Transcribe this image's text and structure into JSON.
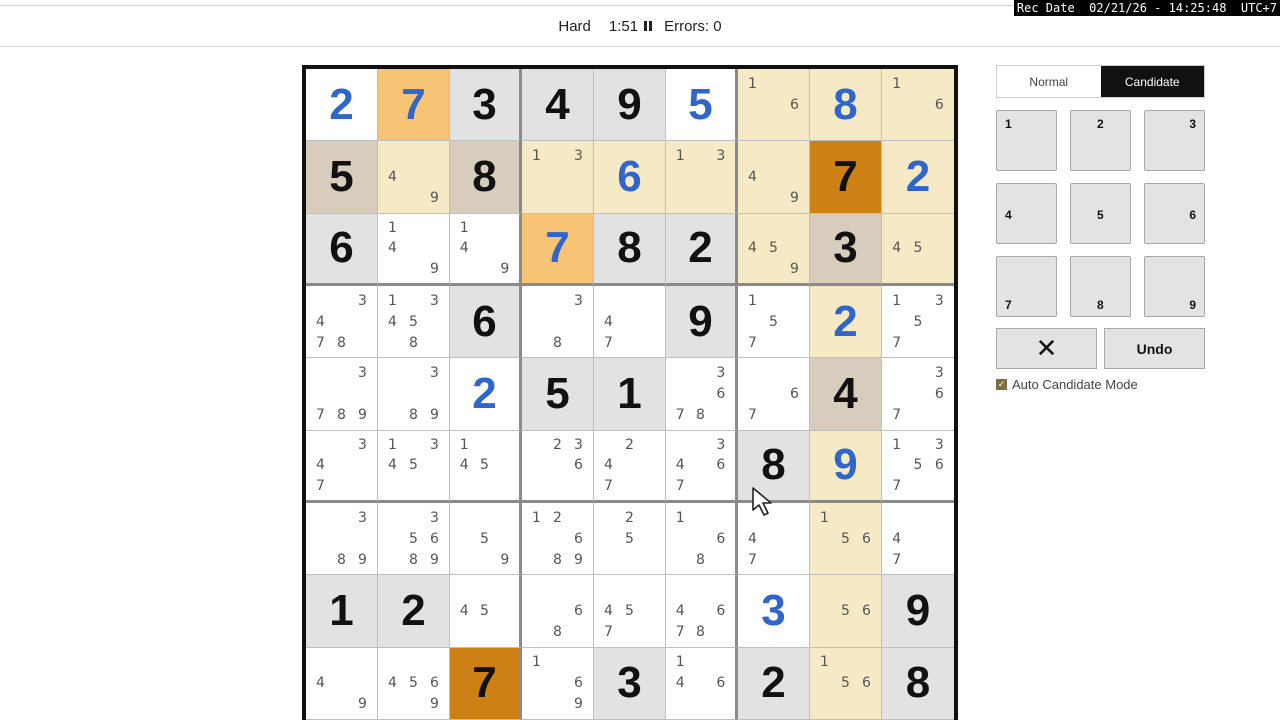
{
  "overlay": {
    "rec_date": "Rec Date  02/21/26 - 14:25:48  UTC+7"
  },
  "header": {
    "difficulty": "Hard",
    "timer": "1:51",
    "errors_label": "Errors: 0"
  },
  "colors": {
    "given": "#111111",
    "entered": "#2f66c9",
    "gray": "#e2e2e2",
    "tan": "#d8cdbc",
    "cream": "#f6e9c5",
    "orange": "#f6c474",
    "dark_orange": "#cd8114"
  },
  "board": [
    [
      {
        "v": "2",
        "t": "entered",
        "bg": "white"
      },
      {
        "v": "7",
        "t": "entered",
        "bg": "orange"
      },
      {
        "v": "3",
        "t": "given",
        "bg": "gray"
      },
      {
        "v": "4",
        "t": "given",
        "bg": "gray"
      },
      {
        "v": "9",
        "t": "given",
        "bg": "gray"
      },
      {
        "v": "5",
        "t": "entered",
        "bg": "white"
      },
      {
        "c": [
          "1",
          "",
          "",
          "",
          "",
          "6",
          "",
          "",
          ""
        ],
        "bg": "cream"
      },
      {
        "v": "8",
        "t": "entered",
        "bg": "cream"
      },
      {
        "c": [
          "1",
          "",
          "",
          "",
          "",
          "6",
          "",
          "",
          ""
        ],
        "bg": "cream"
      }
    ],
    [
      {
        "v": "5",
        "t": "given",
        "bg": "tan"
      },
      {
        "c": [
          "",
          "",
          "",
          "4",
          "",
          "",
          "",
          "",
          "9"
        ],
        "bg": "cream"
      },
      {
        "v": "8",
        "t": "given",
        "bg": "tan"
      },
      {
        "c": [
          "1",
          "",
          "3",
          "",
          "",
          "",
          "",
          "",
          ""
        ],
        "bg": "cream"
      },
      {
        "v": "6",
        "t": "entered",
        "bg": "cream"
      },
      {
        "c": [
          "1",
          "",
          "3",
          "",
          "",
          "",
          "",
          "",
          ""
        ],
        "bg": "cream"
      },
      {
        "c": [
          "",
          "",
          "",
          "4",
          "",
          "",
          "",
          "",
          "9"
        ],
        "bg": "cream"
      },
      {
        "v": "7",
        "t": "given",
        "bg": "dark_orange"
      },
      {
        "v": "2",
        "t": "entered",
        "bg": "cream"
      }
    ],
    [
      {
        "v": "6",
        "t": "given",
        "bg": "gray"
      },
      {
        "c": [
          "1",
          "",
          "",
          "4",
          "",
          "",
          "",
          "",
          "9"
        ],
        "bg": "white"
      },
      {
        "c": [
          "1",
          "",
          "",
          "4",
          "",
          "",
          "",
          "",
          "9"
        ],
        "bg": "white"
      },
      {
        "v": "7",
        "t": "entered",
        "bg": "orange"
      },
      {
        "v": "8",
        "t": "given",
        "bg": "gray"
      },
      {
        "v": "2",
        "t": "given",
        "bg": "gray"
      },
      {
        "c": [
          "",
          "",
          "",
          "4",
          "5",
          "",
          "",
          "",
          "9"
        ],
        "bg": "cream"
      },
      {
        "v": "3",
        "t": "given",
        "bg": "tan"
      },
      {
        "c": [
          "",
          "",
          "",
          "4",
          "5",
          "",
          "",
          "",
          ""
        ],
        "bg": "cream"
      }
    ],
    [
      {
        "c": [
          "",
          "",
          "3",
          "4",
          "",
          "",
          "7",
          "8",
          ""
        ],
        "bg": "white"
      },
      {
        "c": [
          "1",
          "",
          "3",
          "4",
          "5",
          "",
          "",
          "8",
          ""
        ],
        "bg": "white"
      },
      {
        "v": "6",
        "t": "given",
        "bg": "gray"
      },
      {
        "c": [
          "",
          "",
          "3",
          "",
          "",
          "",
          "",
          "8",
          ""
        ],
        "bg": "white"
      },
      {
        "c": [
          "",
          "",
          "",
          "4",
          "",
          "",
          "7",
          "",
          ""
        ],
        "bg": "white"
      },
      {
        "v": "9",
        "t": "given",
        "bg": "gray"
      },
      {
        "c": [
          "1",
          "",
          "",
          "",
          "5",
          "",
          "7",
          "",
          ""
        ],
        "bg": "white"
      },
      {
        "v": "2",
        "t": "entered",
        "bg": "cream"
      },
      {
        "c": [
          "1",
          "",
          "3",
          "",
          "5",
          "",
          "7",
          "",
          ""
        ],
        "bg": "white"
      }
    ],
    [
      {
        "c": [
          "",
          "",
          "3",
          "",
          "",
          "",
          "7",
          "8",
          "9"
        ],
        "bg": "white"
      },
      {
        "c": [
          "",
          "",
          "3",
          "",
          "",
          "",
          "",
          "8",
          "9"
        ],
        "bg": "white"
      },
      {
        "v": "2",
        "t": "entered",
        "bg": "white"
      },
      {
        "v": "5",
        "t": "given",
        "bg": "gray"
      },
      {
        "v": "1",
        "t": "given",
        "bg": "gray"
      },
      {
        "c": [
          "",
          "",
          "3",
          "",
          "",
          "6",
          "7",
          "8",
          ""
        ],
        "bg": "white"
      },
      {
        "c": [
          "",
          "",
          "",
          "",
          "",
          "6",
          "7",
          "",
          ""
        ],
        "bg": "white"
      },
      {
        "v": "4",
        "t": "given",
        "bg": "tan"
      },
      {
        "c": [
          "",
          "",
          "3",
          "",
          "",
          "6",
          "7",
          "",
          ""
        ],
        "bg": "white"
      }
    ],
    [
      {
        "c": [
          "",
          "",
          "3",
          "4",
          "",
          "",
          "7",
          "",
          ""
        ],
        "bg": "white"
      },
      {
        "c": [
          "1",
          "",
          "3",
          "4",
          "5",
          "",
          "",
          "",
          ""
        ],
        "bg": "white"
      },
      {
        "c": [
          "1",
          "",
          "",
          "4",
          "5",
          "",
          "",
          "",
          ""
        ],
        "bg": "white"
      },
      {
        "c": [
          "",
          "2",
          "3",
          "",
          "",
          "6",
          "",
          "",
          ""
        ],
        "bg": "white"
      },
      {
        "c": [
          "",
          "2",
          "",
          "4",
          "",
          "",
          "7",
          "",
          ""
        ],
        "bg": "white"
      },
      {
        "c": [
          "",
          "",
          "3",
          "4",
          "",
          "6",
          "7",
          "",
          ""
        ],
        "bg": "white"
      },
      {
        "v": "8",
        "t": "given",
        "bg": "gray"
      },
      {
        "v": "9",
        "t": "entered",
        "bg": "cream"
      },
      {
        "c": [
          "1",
          "",
          "3",
          "",
          "5",
          "6",
          "7",
          "",
          ""
        ],
        "bg": "white"
      }
    ],
    [
      {
        "c": [
          "",
          "",
          "3",
          "",
          "",
          "",
          "",
          "8",
          "9"
        ],
        "bg": "white"
      },
      {
        "c": [
          "",
          "",
          "3",
          "",
          "5",
          "6",
          "",
          "8",
          "9"
        ],
        "bg": "white"
      },
      {
        "c": [
          "",
          "",
          "",
          "",
          "5",
          "",
          "",
          "",
          "9"
        ],
        "bg": "white"
      },
      {
        "c": [
          "1",
          "2",
          "",
          "",
          "",
          "6",
          "",
          "8",
          "9"
        ],
        "bg": "white"
      },
      {
        "c": [
          "",
          "2",
          "",
          "",
          "5",
          "",
          "",
          "",
          ""
        ],
        "bg": "white"
      },
      {
        "c": [
          "1",
          "",
          "",
          "",
          "",
          "6",
          "",
          "8",
          ""
        ],
        "bg": "white"
      },
      {
        "c": [
          "",
          "",
          "",
          "4",
          "",
          "",
          "7",
          "",
          ""
        ],
        "bg": "white"
      },
      {
        "c": [
          "1",
          "",
          "",
          "",
          "5",
          "6",
          "",
          "",
          ""
        ],
        "bg": "cream"
      },
      {
        "c": [
          "",
          "",
          "",
          "4",
          "",
          "",
          "7",
          "",
          ""
        ],
        "bg": "white"
      }
    ],
    [
      {
        "v": "1",
        "t": "given",
        "bg": "gray"
      },
      {
        "v": "2",
        "t": "given",
        "bg": "gray"
      },
      {
        "c": [
          "",
          "",
          "",
          "4",
          "5",
          "",
          "",
          "",
          ""
        ],
        "bg": "white"
      },
      {
        "c": [
          "",
          "",
          "",
          "",
          "",
          "6",
          "",
          "8",
          ""
        ],
        "bg": "white"
      },
      {
        "c": [
          "",
          "",
          "",
          "4",
          "5",
          "",
          "7",
          "",
          ""
        ],
        "bg": "white"
      },
      {
        "c": [
          "",
          "",
          "",
          "4",
          "",
          "6",
          "7",
          "8",
          ""
        ],
        "bg": "white"
      },
      {
        "v": "3",
        "t": "entered",
        "bg": "white"
      },
      {
        "c": [
          "",
          "",
          "",
          "",
          "5",
          "6",
          "",
          "",
          ""
        ],
        "bg": "cream"
      },
      {
        "v": "9",
        "t": "given",
        "bg": "gray"
      }
    ],
    [
      {
        "c": [
          "",
          "",
          "",
          "4",
          "",
          "",
          "",
          "",
          "9"
        ],
        "bg": "white"
      },
      {
        "c": [
          "",
          "",
          "",
          "4",
          "5",
          "6",
          "",
          "",
          "9"
        ],
        "bg": "white"
      },
      {
        "v": "7",
        "t": "given",
        "bg": "dark_orange"
      },
      {
        "c": [
          "1",
          "",
          "",
          "",
          "",
          "6",
          "",
          "",
          "9"
        ],
        "bg": "white"
      },
      {
        "v": "3",
        "t": "given",
        "bg": "gray"
      },
      {
        "c": [
          "1",
          "",
          "",
          "4",
          "",
          "6",
          "",
          "",
          ""
        ],
        "bg": "white"
      },
      {
        "v": "2",
        "t": "given",
        "bg": "gray"
      },
      {
        "c": [
          "1",
          "",
          "",
          "",
          "5",
          "6",
          "",
          "",
          ""
        ],
        "bg": "cream"
      },
      {
        "v": "8",
        "t": "given",
        "bg": "gray"
      }
    ]
  ],
  "controls": {
    "mode_normal": "Normal",
    "mode_candidate": "Candidate",
    "numpad": [
      "1",
      "2",
      "3",
      "4",
      "5",
      "6",
      "7",
      "8",
      "9"
    ],
    "clear_symbol": "✕",
    "undo_label": "Undo",
    "auto_candidate_label": "Auto Candidate Mode",
    "auto_candidate_checked": true
  }
}
